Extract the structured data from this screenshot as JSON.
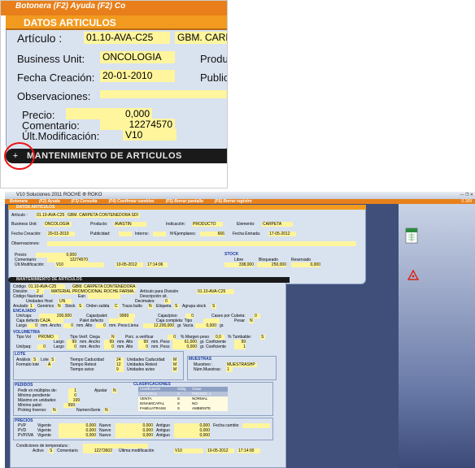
{
  "zoom": {
    "topmenu": "Botonera          (F2) Ayuda           (F2) Co",
    "header": "DATOS ARTICULOS",
    "articulo_label": "Artículo :",
    "articulo_value": "01.10-AVA-C25",
    "articulo_desc": "GBM. CARPET",
    "bu_label": "Business Unit:",
    "bu_value": "ONCOLOGIA",
    "produ_label": "Produ",
    "fecha_label": "Fecha Creación:",
    "fecha_value": "20-01-2010",
    "public_label": "Public",
    "obs_label": "Observaciones:",
    "precio_label": "Precio:",
    "precio_value": "0,000",
    "comentario_label": "Comentario:",
    "comentario_value": "12274570",
    "ultmod_label": "Últ.Modificación:",
    "ultmod_value": "V10",
    "bar": "MANTENIMIENTO DE ARTICULOS",
    "plus": "+"
  },
  "window": {
    "title": "V10 Soluciones 2011 ROCHE Φ ROKO",
    "menu": [
      "Botonera",
      "(F2) Ayuda",
      "(F3) Consulta",
      "(F4) Confirmar cambios",
      "(F5) Borrar pantalla",
      "(F6) Borrar registro"
    ],
    "version": "0.189"
  },
  "p1": {
    "head": "DATOS ARTICULOS",
    "articulo_label": "Artículo :",
    "articulo": "01.10-AVA-C25",
    "articulo_desc": "GBM. CARPETA CONTENEDORA SDI",
    "bu_label": "Business Unit:",
    "bu": "ONCOLOGIA",
    "producto_label": "Producto:",
    "producto": "AVASTIN",
    "indicacion_label": "Indicación:",
    "indicacion": "PRODUCTO",
    "elemento_label": "Elemento:",
    "elemento": "CARPETA",
    "fc_label": "Fecha Creación:",
    "fc": "20-01-2010",
    "public_label": "Publicidad:",
    "interno_label": "Interno:",
    "npe_label": "NºEjemplares:",
    "npe": "666",
    "fe_label": "Fecha Entrada:",
    "fe": "17-05-2012",
    "obs_label": "Observaciones:",
    "precio_label": "Precio:",
    "precio": "0,000",
    "coment_label": "Comentario:",
    "coment": "12274570",
    "ult_label": "Últ.Modificación:",
    "ult": "V10",
    "ult_date": "10-05-2012",
    "ult_time": "17:14:06",
    "stock": "STOCK",
    "libre_label": "Libre",
    "libre": "338,000",
    "bloq_label": "Bloqueado",
    "bloq": "250,000",
    "reserv_label": "Reservado",
    "reserv": "0,000"
  },
  "p2": {
    "bar": "MANTENIMIENTO DE ARTICULOS",
    "codigo_label": "Código",
    "codigo": "01.10-AVA-C25",
    "codigo_desc": "GBM. CARPETA CONTENEDORA SDI",
    "division_label": "División",
    "division": "2",
    "division_desc": "MATERIAL PROMOCIONAL ROCHE FARMA, S.A.",
    "apd_label": "Artículo para División",
    "apd": "01.10-AVA-C25",
    "cn_label": "Código Nacional",
    "ean_label": "Ean",
    "dsit_label": "Descripción sit.",
    "um_label": "Unidades Host",
    "um": "UN",
    "dec_label": "Decimales:",
    "dec": "0",
    "anulado_label": "Anulado",
    "anulado": "1",
    "generico_label": "Genérico",
    "generico": "N",
    "stock_label": "Stock",
    "stock": "S",
    "orden_label": "Orden salida",
    "orden": "C",
    "traza_label": "Traza bulto",
    "traza": "N",
    "etiq_label": "Etiqueta",
    "etiq": "S",
    "agrupa_label": "Agrupa stock",
    "agrupa": "S",
    "encajado": "ENCAJADO",
    "uc_label": "Uni/caja:",
    "uc": "200,000",
    "cp_label": "Cajas/palet:",
    "cp": "9999",
    "cpiso_label": "Cajas/piso:",
    "cpiso": "0",
    "cpc_label": "Cases por Cubeta:",
    "cpc": "0",
    "cd_label": "Caja defecto",
    "cd": "CAJA",
    "pd_label": "Palet defecto",
    "ccomp_label": "Caja completa: Tipo",
    "peso_label": "Pesar",
    "peso": "N",
    "largo_label": "Largo",
    "largo": "0",
    "ancho_label": "mm. Ancho",
    "ancho": "0",
    "alto_label": "mm. Alto",
    "alto": "0",
    "pll_label": "mm. Peso:Llena",
    "pll": "12.200,000",
    "vacia_label": "gr. Vacía",
    "vacia": "0,000",
    "gr": "gr.",
    "volumetria": "VOLUMETRIA",
    "tv_label": "Tipo Vol",
    "tv": "PROMO",
    "tvc_label": "Tipo Verif. Ciega",
    "tvc": "N",
    "pav_label": "Porc. a verificar",
    "pav": "0",
    "mp_label": "% Margen peso",
    "mp": "0,0",
    "tumb_label": "% Tumbable:",
    "tumb": "S",
    "v_largo_label": "Largo",
    "v_largo": "99",
    "v_ancho_label": "mm. Ancho",
    "v_ancho": "99",
    "v_alto_label": "mm. Alto",
    "v_alto": "99",
    "v_peso_label": "mm. Peso",
    "v_peso": "61,000",
    "v_coef_label": "gr. Coeficiente",
    "v_coef": "99",
    "uxp_label": "Uni/paq:",
    "uxp": "0",
    "u_largo": "0",
    "u_ancho": "0",
    "u_alto": "0",
    "u_peso": "0,000",
    "u_coef": "1",
    "lote": "LOTE",
    "analisis_label": "Análisis",
    "analisis": "S",
    "lote_label": "Lote",
    "lote_v": "S",
    "formato_label": "Formato lote",
    "formato": "A",
    "tc_label": "Tiempo Caducidad",
    "tc": "24",
    "uc2_label": "Unidades Caducidad",
    "uc2": "M",
    "tr_label": "Tiempo Retest",
    "tr": "12",
    "ur_label": "Unidades Retest",
    "ur": "M",
    "ta_label": "Tiempo aviso",
    "ta": "9",
    "ua_label": "Unidades aviso",
    "ua": "M",
    "muestras": "MUESTRAS",
    "muestreo_label": "Muestreo :",
    "muestreo": "MUESTRASHP",
    "num_label": "Núm.Muestras:",
    "num": "1",
    "pedidos": "PEDIDOS",
    "pmult_label": "Pedir en múltiplos de:",
    "pmult": "1",
    "ajustar_label": "Ajustar",
    "ajustar": "N",
    "minp_label": "Mínimo pendiente",
    "minp": "0",
    "maxu_label": "Máximo en unidades:",
    "maxu": "199",
    "minpal_label": "Mínimo palet:",
    "minpal": "999",
    "pick_label": "Picking Inverso:",
    "pick": "N",
    "nserie_label": "NumeroSerie",
    "nserie": "N",
    "clasif": "CLASIFICACIONES",
    "clasif_head": [
      "Clasificación",
      "Oblig",
      "Clase"
    ],
    "clasif_rows": [
      [
        "GENERAL",
        "S",
        "PRESEN: 1"
      ],
      [
        "VENTA",
        "S",
        "NORMAL"
      ],
      [
        "DINAMICAPAL",
        "S",
        "NO"
      ],
      [
        "FAMILIATRANS",
        "S",
        "AMBIENTE"
      ]
    ],
    "precios": "PRECIOS",
    "pvp_label": "PVP",
    "pvd_label": "PVD",
    "pvpiva_label": "PVP/IVA",
    "vig_label": "Vigente",
    "nuevo_label": "Nuevo",
    "antiguo_label": "Antiguo",
    "fc_label": "Fecha cambio",
    "zero": "0,000",
    "temp_label": "Condiciones de temperatura :",
    "activo_label": "Activo",
    "activo": "S",
    "coment_label": "Comentario",
    "coment": "12273602",
    "um_label2": "Última modificación",
    "um2": "V10",
    "umd": "10-05-2012",
    "umt": "17:14:00"
  }
}
